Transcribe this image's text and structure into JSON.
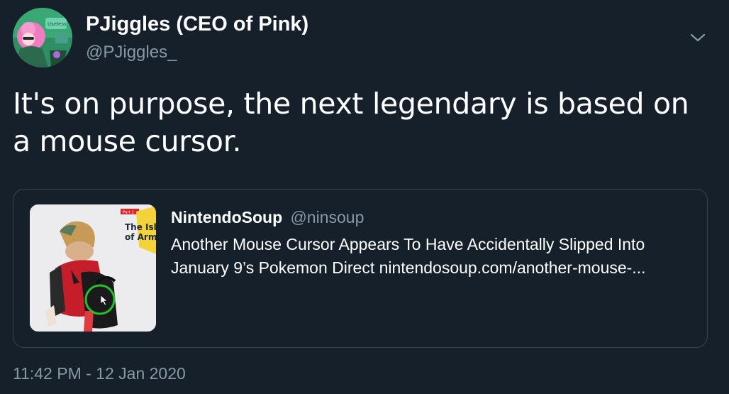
{
  "author": {
    "display_name": "PJiggles (CEO of Pink)",
    "handle": "@PJiggles_",
    "avatar_icon": "avatar-illustration"
  },
  "tweet": {
    "text": "It's on purpose, the next legendary is based on a mouse cursor.",
    "timestamp": "11:42 PM - 12 Jan 2020",
    "menu_icon": "chevron-down-icon"
  },
  "quoted": {
    "name": "NintendoSoup",
    "handle": "@ninsoup",
    "text": "Another Mouse Cursor Appears To Have Accidentally Slipped Into January 9’s Pokemon Direct nintendosoup.com/another-mouse-...",
    "thumbnail": {
      "badge": "Part 1",
      "title_line1": "The Isle",
      "title_line2": "of Armo"
    }
  },
  "colors": {
    "background": "#15202b",
    "border": "#38444d",
    "secondary_text": "#8899a6",
    "primary_text": "#ffffff",
    "highlight_circle": "#22c02a"
  }
}
